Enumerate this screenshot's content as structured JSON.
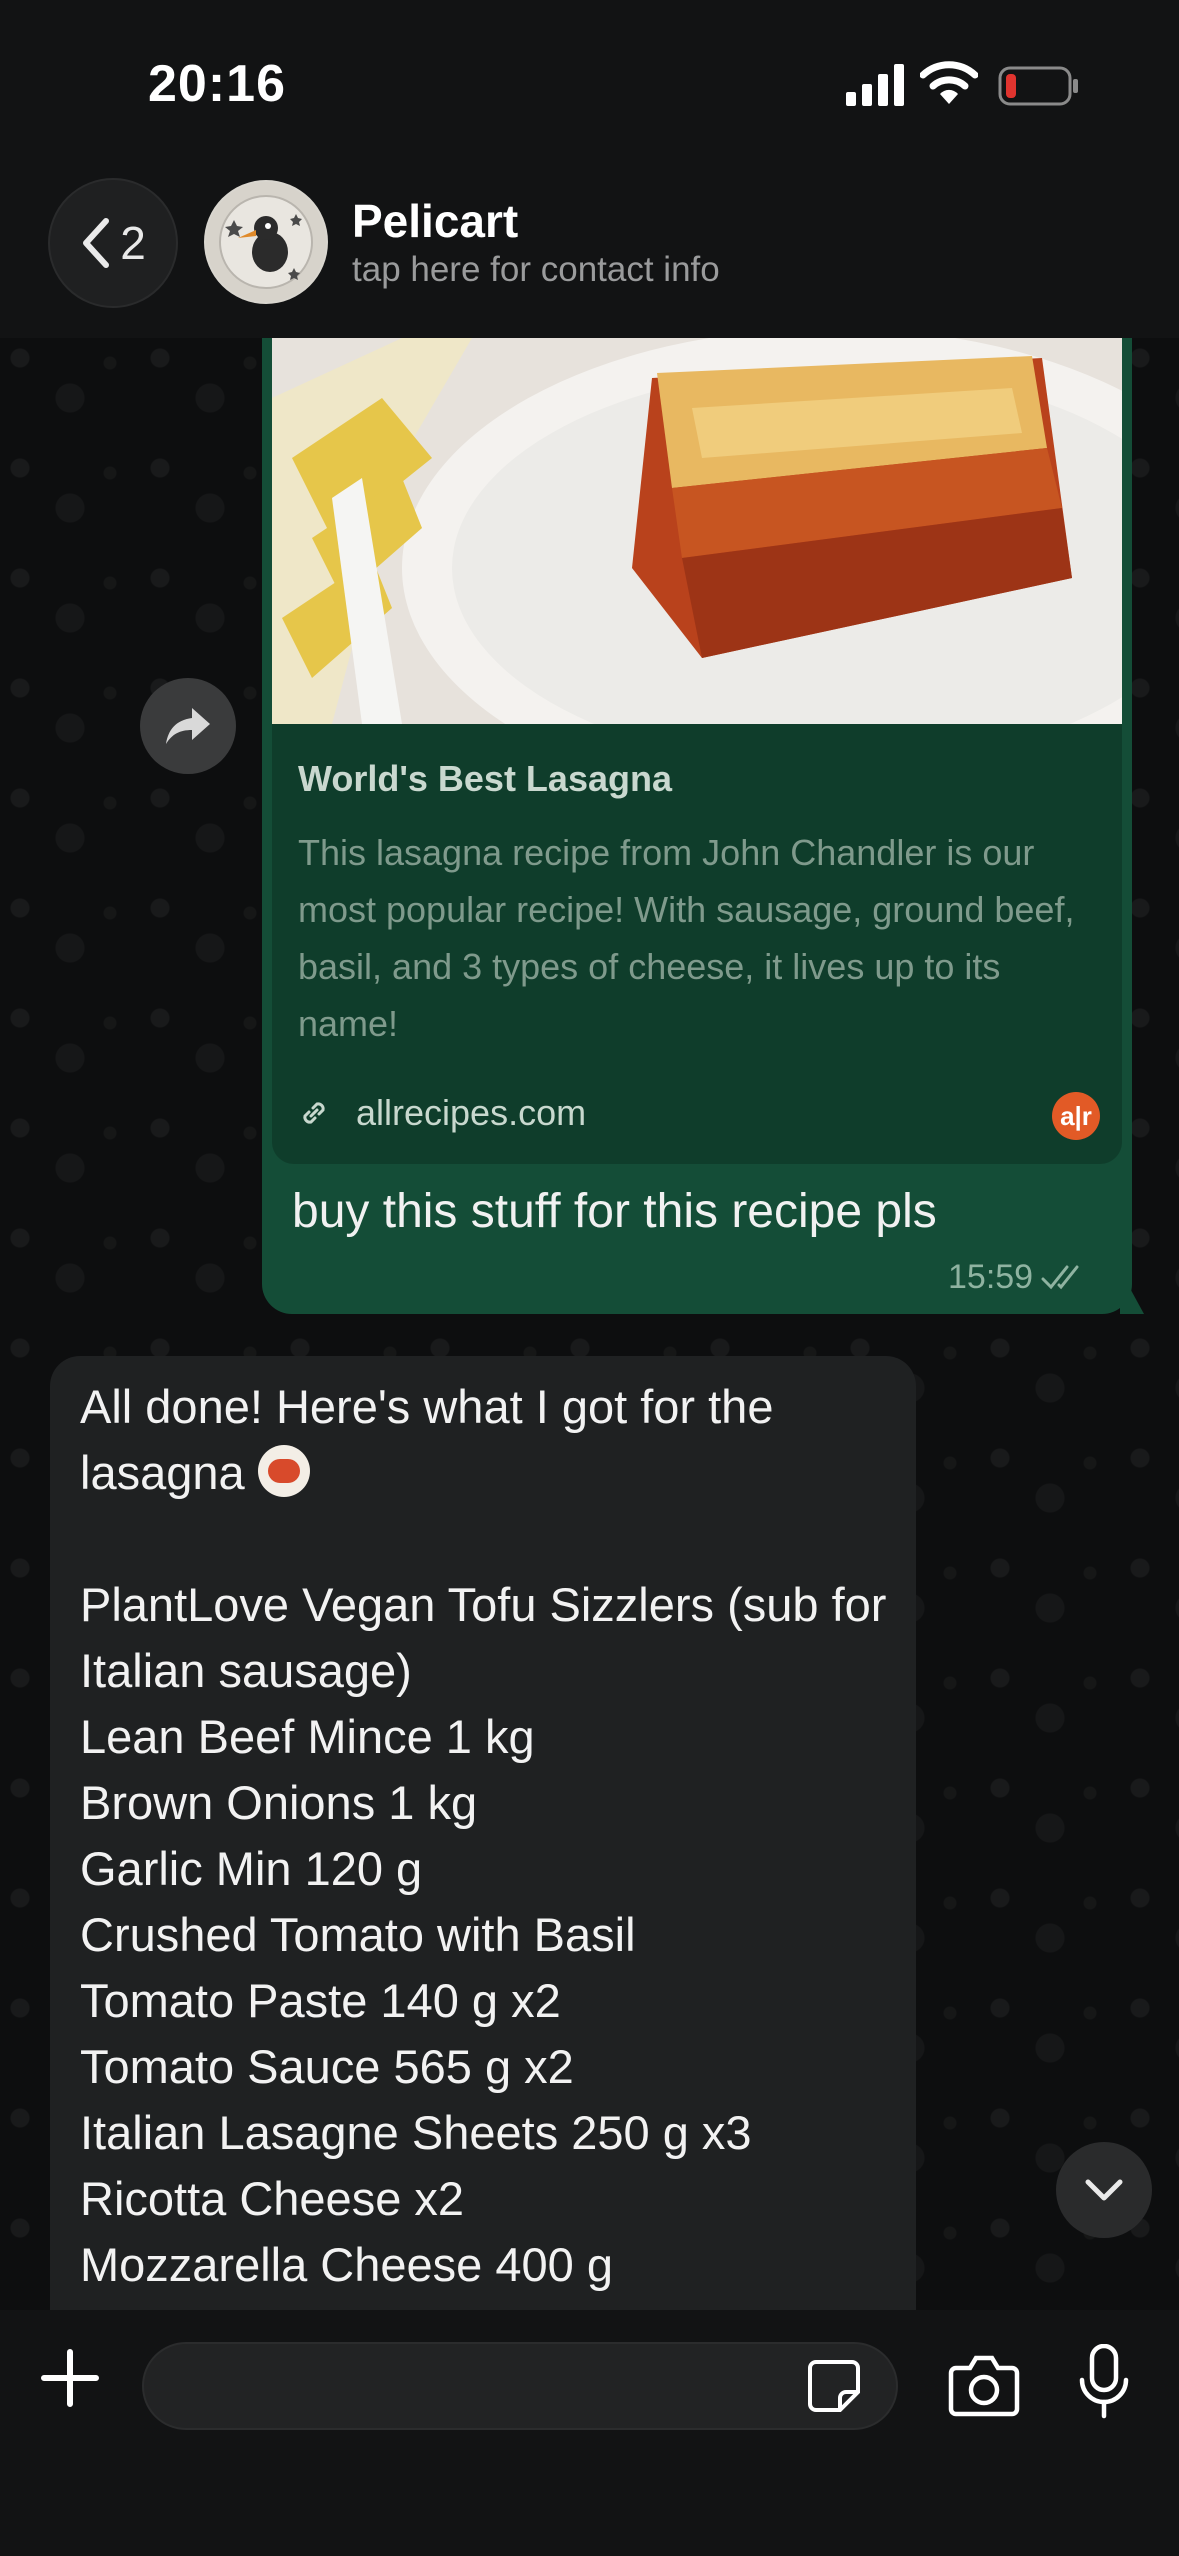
{
  "status_bar": {
    "time": "20:16"
  },
  "header": {
    "back_count": "2",
    "contact_name": "Pelicart",
    "contact_subtitle": "tap here for contact info"
  },
  "outgoing_message": {
    "link_preview": {
      "title": "World's Best Lasagna",
      "description": "This lasagna recipe from John Chandler is our most popular recipe! With sausage, ground beef, basil, and 3 types of cheese, it lives up to its name!",
      "domain": "allrecipes.com",
      "site_logo": "a|r"
    },
    "text": "buy this stuff for this recipe pls",
    "time": "15:59",
    "status": "double-check-read"
  },
  "incoming_message": {
    "intro_line1": "All done! Here's what I got for the",
    "intro_line2": "lasagna",
    "items": [
      "PlantLove Vegan Tofu Sizzlers (sub for Italian sausage)",
      "Lean Beef Mince 1 kg",
      "Brown Onions 1 kg",
      "Garlic Min 120 g",
      "Crushed Tomato with Basil",
      "Tomato Paste 140 g x2",
      "Tomato Sauce 565 g x2",
      "Italian Lasagne Sheets 250 g x3",
      "Ricotta Cheese x2",
      "Mozzarella Cheese 400 g"
    ]
  },
  "icons": {
    "back": "chevron-left-icon",
    "forward": "forward-arrow-icon",
    "link": "link-icon",
    "scroll_down": "chevron-down-icon",
    "plus": "plus-icon",
    "sticker": "sticker-icon",
    "camera": "camera-icon",
    "mic": "microphone-icon"
  },
  "colors": {
    "outgoing_bubble": "#144d37",
    "incoming_bubble": "#1f2122",
    "battery_low": "#e0342f"
  }
}
